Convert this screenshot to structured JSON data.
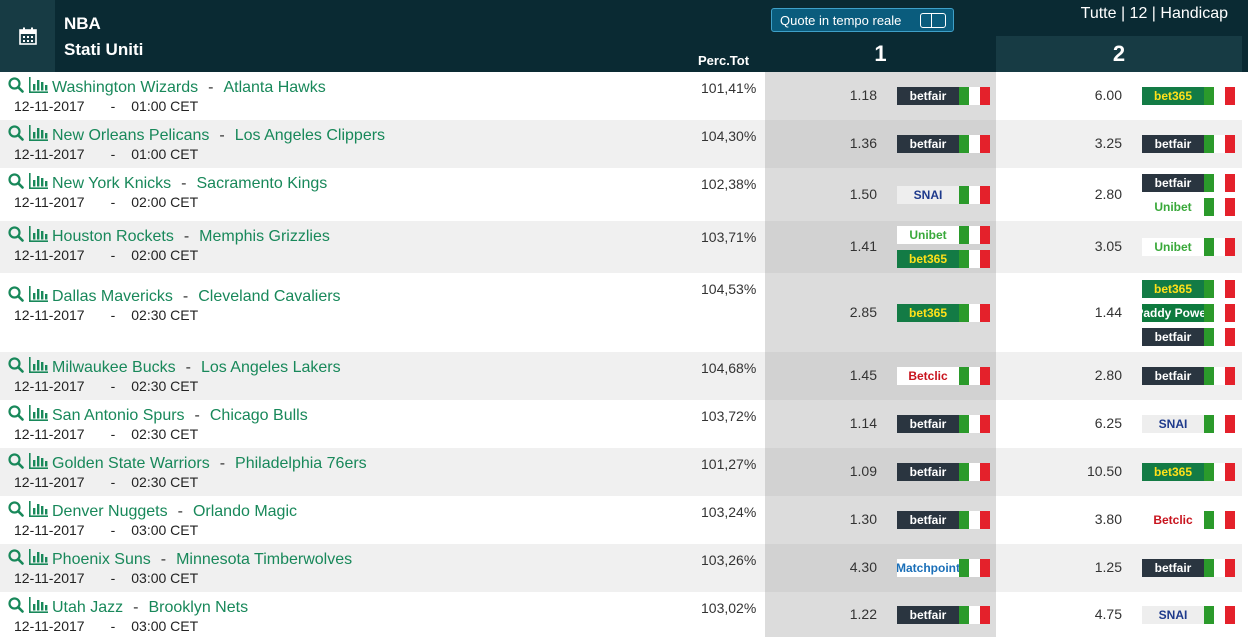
{
  "header": {
    "league": "NBA",
    "country": "Stati Uniti",
    "perc_label": "Perc.Tot",
    "realtime_label": "Quote in tempo reale",
    "filter": "Tutte | 12 | Handicap",
    "col1": "1",
    "col2": "2"
  },
  "colors": {
    "header_bg": "#0a2a33",
    "team_green": "#18885a",
    "realtime_bg": "#0a5c7d",
    "bet365": "#137b45",
    "betfair": "#2a3540",
    "snai": "#1e3a8c",
    "matchpoint": "#1a6fb8",
    "betclic": "#c8141e",
    "paddy": "#0d7a3e",
    "unibet": "#39a93a"
  },
  "bookmakers": {
    "betfair": "betfair",
    "bet365": "bet365",
    "snai": "SNAI",
    "unibet": "Unibet",
    "paddy": "Paddy Power",
    "betclic": "Betclic",
    "matchpoint": "Matchpoint"
  },
  "rows": [
    {
      "home": "Washington Wizards",
      "away": "Atlanta Hawks",
      "date": "12-11-2017",
      "sep": "-",
      "time": "01:00 CET",
      "perc": "101,41%",
      "o1": "1.18",
      "b1": [
        "betfair"
      ],
      "o2": "6.00",
      "b2": [
        "bet365"
      ]
    },
    {
      "home": "New Orleans Pelicans",
      "away": "Los Angeles Clippers",
      "date": "12-11-2017",
      "sep": "-",
      "time": "01:00 CET",
      "perc": "104,30%",
      "o1": "1.36",
      "b1": [
        "betfair"
      ],
      "o2": "3.25",
      "b2": [
        "betfair"
      ]
    },
    {
      "home": "New York Knicks",
      "away": "Sacramento Kings",
      "date": "12-11-2017",
      "sep": "-",
      "time": "02:00 CET",
      "perc": "102,38%",
      "o1": "1.50",
      "b1": [
        "snai"
      ],
      "o2": "2.80",
      "b2": [
        "betfair",
        "unibet"
      ]
    },
    {
      "home": "Houston Rockets",
      "away": "Memphis Grizzlies",
      "date": "12-11-2017",
      "sep": "-",
      "time": "02:00 CET",
      "perc": "103,71%",
      "o1": "1.41",
      "b1": [
        "unibet",
        "bet365"
      ],
      "o2": "3.05",
      "b2": [
        "unibet"
      ]
    },
    {
      "home": "Dallas Mavericks",
      "away": "Cleveland Cavaliers",
      "date": "12-11-2017",
      "sep": "-",
      "time": "02:30 CET",
      "perc": "104,53%",
      "o1": "2.85",
      "b1": [
        "bet365"
      ],
      "o2": "1.44",
      "b2": [
        "bet365",
        "paddy",
        "betfair"
      ]
    },
    {
      "home": "Milwaukee Bucks",
      "away": "Los Angeles Lakers",
      "date": "12-11-2017",
      "sep": "-",
      "time": "02:30 CET",
      "perc": "104,68%",
      "o1": "1.45",
      "b1": [
        "betclic"
      ],
      "o2": "2.80",
      "b2": [
        "betfair"
      ]
    },
    {
      "home": "San Antonio Spurs",
      "away": "Chicago Bulls",
      "date": "12-11-2017",
      "sep": "-",
      "time": "02:30 CET",
      "perc": "103,72%",
      "o1": "1.14",
      "b1": [
        "betfair"
      ],
      "o2": "6.25",
      "b2": [
        "snai"
      ]
    },
    {
      "home": "Golden State Warriors",
      "away": "Philadelphia 76ers",
      "date": "12-11-2017",
      "sep": "-",
      "time": "02:30 CET",
      "perc": "101,27%",
      "o1": "1.09",
      "b1": [
        "betfair"
      ],
      "o2": "10.50",
      "b2": [
        "bet365"
      ]
    },
    {
      "home": "Denver Nuggets",
      "away": "Orlando Magic",
      "date": "12-11-2017",
      "sep": "-",
      "time": "03:00 CET",
      "perc": "103,24%",
      "o1": "1.30",
      "b1": [
        "betfair"
      ],
      "o2": "3.80",
      "b2": [
        "betclic"
      ]
    },
    {
      "home": "Phoenix Suns",
      "away": "Minnesota Timberwolves",
      "date": "12-11-2017",
      "sep": "-",
      "time": "03:00 CET",
      "perc": "103,26%",
      "o1": "4.30",
      "b1": [
        "matchpoint"
      ],
      "o2": "1.25",
      "b2": [
        "betfair"
      ]
    },
    {
      "home": "Utah Jazz",
      "away": "Brooklyn Nets",
      "date": "12-11-2017",
      "sep": "-",
      "time": "03:00 CET",
      "perc": "103,02%",
      "o1": "1.22",
      "b1": [
        "betfair"
      ],
      "o2": "4.75",
      "b2": [
        "snai"
      ]
    }
  ]
}
